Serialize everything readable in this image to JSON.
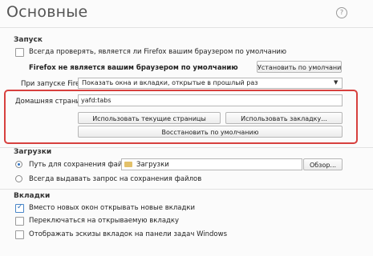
{
  "header": {
    "title": "Основные",
    "help_icon": "?"
  },
  "startup": {
    "section_title": "Запуск",
    "check_default": {
      "label": "Всегда проверять, является ли Firefox вашим браузером по умолчанию",
      "checked": false
    },
    "not_default_text": "Firefox не является вашим браузером по умолчанию",
    "set_default_button": "Установить по умолчанию",
    "on_launch_label": "При запуске Firefox:",
    "on_launch_value": "Показать окна и вкладки, открытые в прошлый раз",
    "homepage_label": "Домашняя страница:",
    "homepage_value": "yafd:tabs",
    "use_current_button": "Использовать текущие страницы",
    "use_bookmark_button": "Использовать закладку...",
    "restore_default_button": "Восстановить по умолчанию"
  },
  "downloads": {
    "section_title": "Загрузки",
    "save_path_label": "Путь для сохранения файлов",
    "folder_name": "Загрузки",
    "browse_button": "Обзор...",
    "always_ask_label": "Всегда выдавать запрос на сохранения файлов",
    "selected": "save_path"
  },
  "tabs": {
    "section_title": "Вкладки",
    "items": [
      {
        "label": "Вместо новых окон открывать новые вкладки",
        "checked": true
      },
      {
        "label": "Переключаться на открываемую вкладку",
        "checked": false
      },
      {
        "label": "Отображать эскизы вкладок на панели задач Windows",
        "checked": false
      }
    ]
  },
  "colors": {
    "highlight": "#d7403e",
    "accent": "#2f73c4"
  }
}
